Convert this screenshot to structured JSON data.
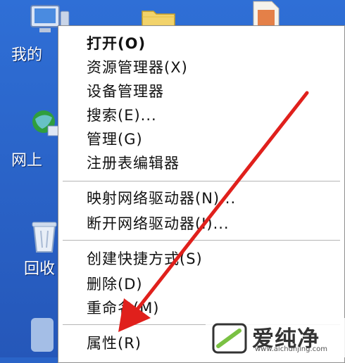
{
  "desktop": {
    "icons": [
      {
        "label": "我的",
        "icon": "my-computer-icon"
      },
      {
        "label": "网上",
        "icon": "network-places-icon"
      },
      {
        "label": "回收",
        "icon": "recycle-bin-icon"
      },
      {
        "icon": "folder-icon"
      },
      {
        "icon": "document-icon"
      }
    ]
  },
  "context_menu": {
    "items": [
      {
        "label": "打开(O)",
        "default": true
      },
      {
        "label": "资源管理器(X)"
      },
      {
        "label": "设备管理器"
      },
      {
        "label": "搜索(E)..."
      },
      {
        "label": "管理(G)"
      },
      {
        "label": "注册表编辑器"
      },
      {
        "label": "映射网络驱动器(N)..."
      },
      {
        "label": "断开网络驱动器(I)..."
      },
      {
        "label": "创建快捷方式(S)"
      },
      {
        "label": "删除(D)"
      },
      {
        "label": "重命名(M)"
      },
      {
        "label": "属性(R)",
        "highlighted_by_arrow": true
      }
    ]
  },
  "annotation": {
    "arrow_color": "#e0201c"
  },
  "watermark": {
    "brand": "爱纯净",
    "url": "www.aichunjing.com",
    "color": "#7ac143"
  }
}
